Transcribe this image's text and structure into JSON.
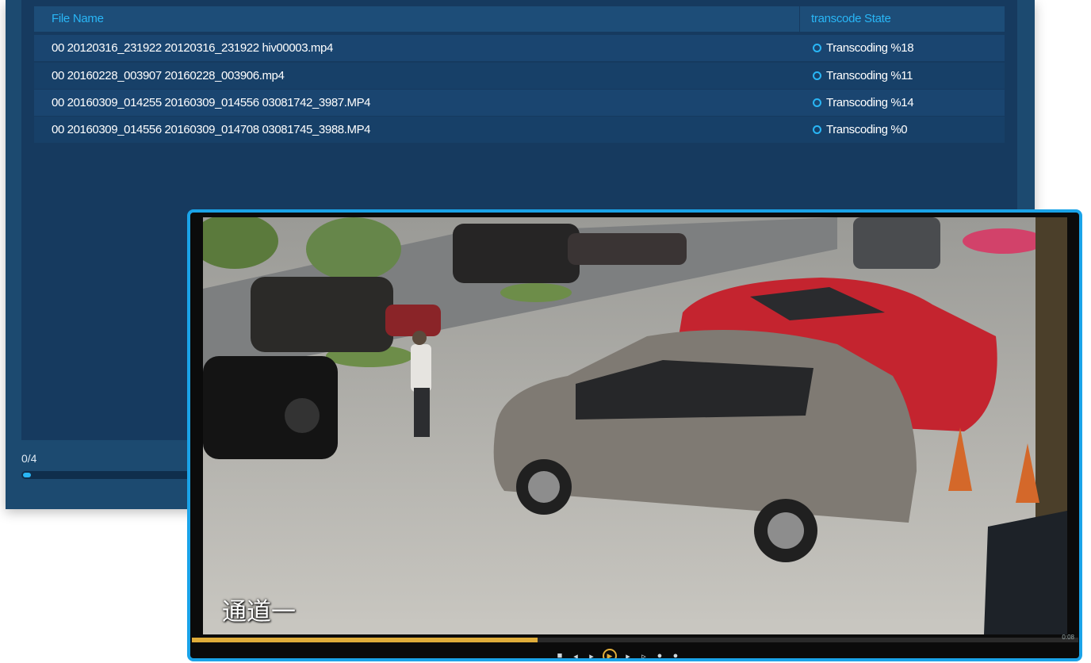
{
  "transcode": {
    "columns": {
      "file_name": "File Name",
      "state": "transcode State"
    },
    "rows": [
      {
        "file_name": "00 20120316_231922 20120316_231922 hiv00003.mp4",
        "state": "Transcoding %18"
      },
      {
        "file_name": "00 20160228_003907 20160228_003906.mp4",
        "state": "Transcoding %11"
      },
      {
        "file_name": "00 20160309_014255 20160309_014556 03081742_3987.MP4",
        "state": "Transcoding %14"
      },
      {
        "file_name": "00 20160309_014556 20160309_014708 03081745_3988.MP4",
        "state": "Transcoding %0"
      }
    ],
    "progress_label": "0/4",
    "progress_fraction": 0.04,
    "accent_color": "#29b6f6"
  },
  "player": {
    "channel_label": "通道一",
    "playback_fraction": 0.39,
    "time_label": "0:08",
    "accent_color": "#e0ad3a",
    "border_color": "#1aa3e8",
    "controls": [
      "stop-icon",
      "prev-icon",
      "rewind-icon",
      "play-icon",
      "forward-icon",
      "next-icon",
      "volume-icon",
      "fullscreen-icon"
    ]
  }
}
